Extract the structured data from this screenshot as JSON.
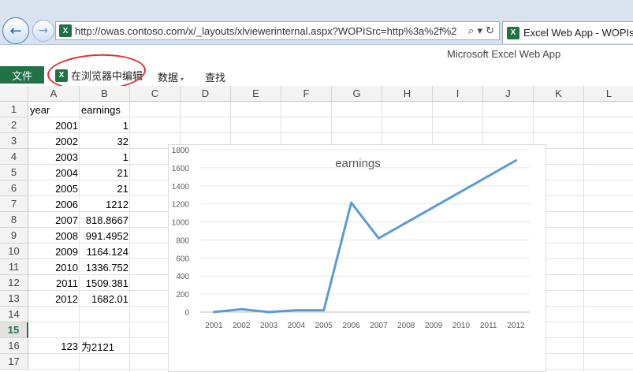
{
  "browser": {
    "url": "http://owas.contoso.com/x/_layouts/xlviewerinternal.aspx?WOPISrc=http%3a%2f%2",
    "tab_title": "Excel Web App - WOPIs",
    "back_glyph": "←",
    "forward_glyph": "→",
    "addr_icons": "⌕ ▾ ↻",
    "site_icon": "X"
  },
  "ribbon": {
    "app_title": "Microsoft Excel Web App",
    "file_label": "文件",
    "edit_in_browser_label": "在浏览器中编辑",
    "data_label": "数据",
    "data_caret": "▾",
    "find_label": "查找",
    "icon": "X"
  },
  "sheet": {
    "columns": [
      "A",
      "B",
      "C",
      "D",
      "E",
      "F",
      "G",
      "H",
      "I",
      "J",
      "K",
      "L"
    ],
    "rows": [
      "1",
      "2",
      "3",
      "4",
      "5",
      "6",
      "7",
      "8",
      "9",
      "10",
      "11",
      "12",
      "13",
      "14",
      "15",
      "16",
      "17"
    ],
    "active_row": "15",
    "cells": {
      "A1": "year",
      "B1": "earnings",
      "A2": "2001",
      "B2": "1",
      "A3": "2002",
      "B3": "32",
      "A4": "2003",
      "B4": "1",
      "A5": "2004",
      "B5": "21",
      "A6": "2005",
      "B6": "21",
      "A7": "2006",
      "B7": "1212",
      "A8": "2007",
      "B8": "818.8667",
      "A9": "2008",
      "B9": "991.4952",
      "A10": "2009",
      "B10": "1164.124",
      "A11": "2010",
      "B11": "1336.752",
      "A12": "2011",
      "B12": "1509.381",
      "A13": "2012",
      "B13": "1682.01",
      "A16": "123",
      "B16": "为2121"
    }
  },
  "chart_data": {
    "type": "line",
    "title": "earnings",
    "categories": [
      "2001",
      "2002",
      "2003",
      "2004",
      "2005",
      "2006",
      "2007",
      "2008",
      "2009",
      "2010",
      "2011",
      "2012"
    ],
    "series": [
      {
        "values": [
          1,
          32,
          1,
          21,
          21,
          1212,
          818.8667,
          991.4952,
          1164.124,
          1336.752,
          1509.381,
          1682.01
        ]
      }
    ],
    "yticks": [
      "0",
      "200",
      "400",
      "600",
      "800",
      "1000",
      "1200",
      "1400",
      "1600",
      "1800"
    ],
    "ylim": [
      0,
      1800
    ],
    "grid": true,
    "line_color": "#5b9bd5"
  }
}
